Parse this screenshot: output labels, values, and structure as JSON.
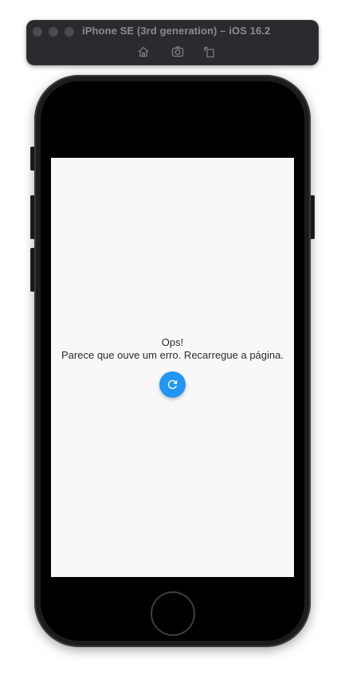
{
  "simulator": {
    "title": "iPhone SE (3rd generation) – iOS 16.2",
    "toolbar": [
      "home-icon",
      "screenshot-icon",
      "rotate-icon"
    ]
  },
  "app": {
    "error_title": "Ops!",
    "error_message": "Parece que ouve um erro. Recarregue a página.",
    "reload_icon": "refresh-icon",
    "accent_color": "#2196f3",
    "background_color": "#f8f8f8"
  }
}
